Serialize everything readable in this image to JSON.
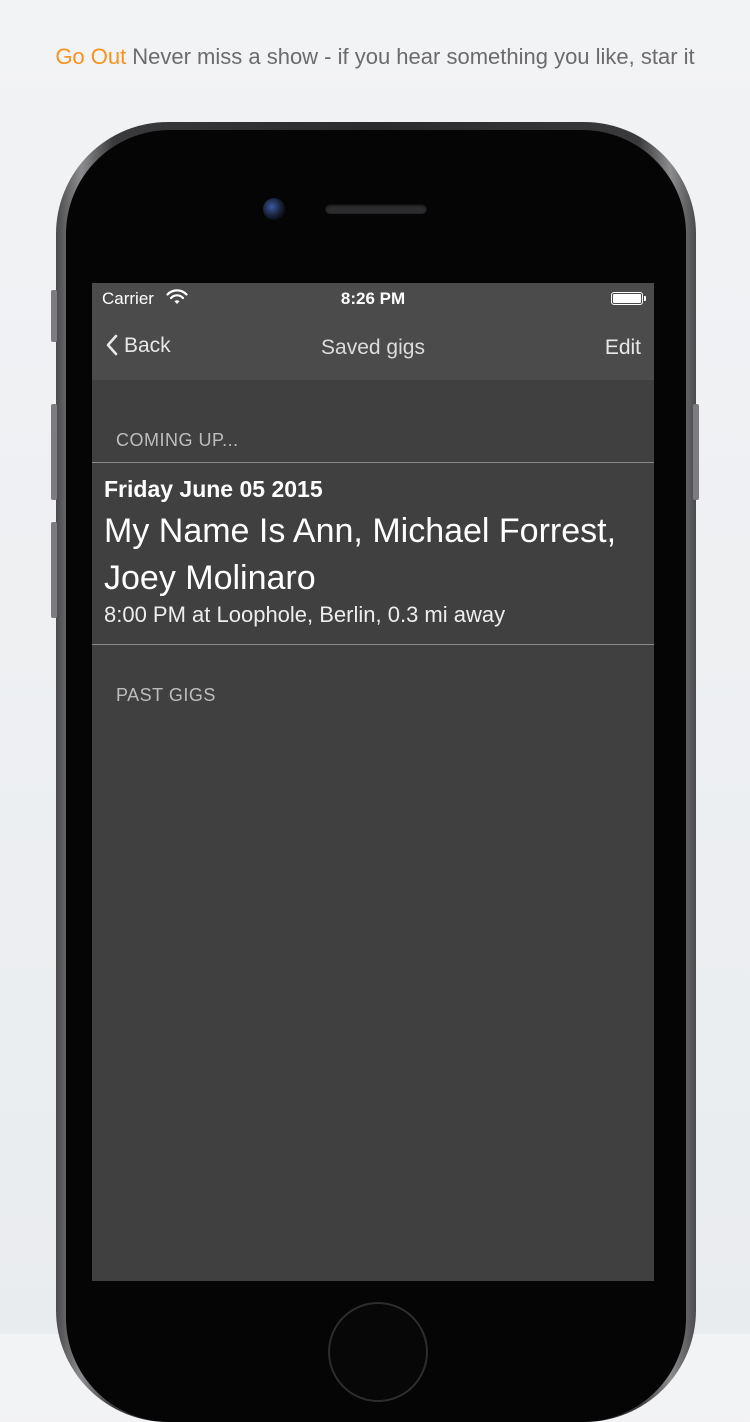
{
  "promo": {
    "brand": "Go Out",
    "tagline": "Never miss a show - if you hear something you like, star it"
  },
  "status_bar": {
    "carrier": "Carrier",
    "time": "8:26 PM"
  },
  "nav_bar": {
    "back_label": "Back",
    "title": "Saved gigs",
    "edit_label": "Edit"
  },
  "sections": {
    "upcoming_header": "COMING UP...",
    "past_header": "PAST GIGS"
  },
  "upcoming_gigs": [
    {
      "date": "Friday June 05 2015",
      "artists": "My Name Is Ann, Michael Forrest, Joey Molinaro",
      "details": "8:00 PM at Loophole, Berlin, 0.3 mi away"
    }
  ],
  "colors": {
    "brand_accent": "#f7931e",
    "screen_background": "#404040",
    "bar_background": "#4b4b4b"
  },
  "icons": [
    "wifi-icon",
    "battery-icon",
    "chevron-left-icon"
  ]
}
